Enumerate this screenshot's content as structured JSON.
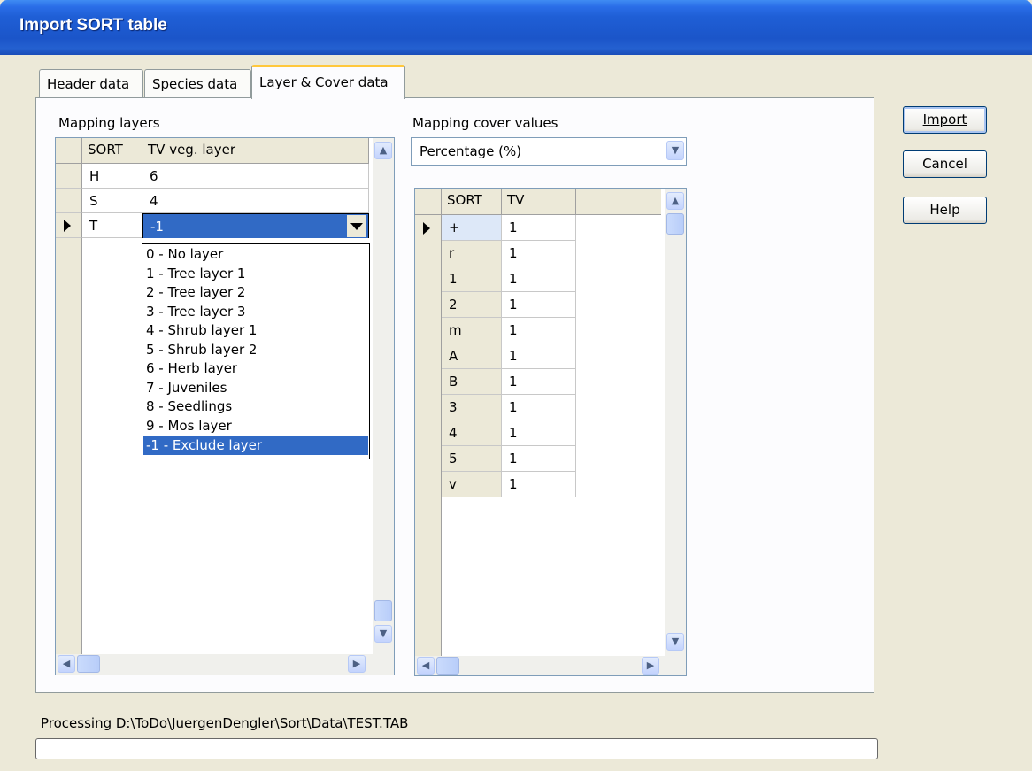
{
  "window": {
    "title": "Import SORT table"
  },
  "tabs": [
    {
      "label": "Header data"
    },
    {
      "label": "Species data"
    },
    {
      "label": "Layer & Cover data"
    }
  ],
  "layers": {
    "label": "Mapping layers",
    "headers": [
      "SORT",
      "TV veg. layer"
    ],
    "rows": [
      {
        "sort": "H",
        "tv": "6"
      },
      {
        "sort": "S",
        "tv": "4"
      },
      {
        "sort": "T",
        "tv": "-1"
      }
    ],
    "dropdown_options": [
      "0 - No layer",
      "1 - Tree layer 1",
      "2 - Tree layer 2",
      "3 - Tree layer 3",
      "4 - Shrub layer 1",
      "5 - Shrub layer 2",
      "6 - Herb layer",
      "7 - Juveniles",
      "8 - Seedlings",
      "9 - Mos layer",
      "-1 - Exclude layer"
    ],
    "dropdown_selected": "-1 - Exclude layer"
  },
  "cover": {
    "label": "Mapping cover values",
    "combo_value": "Percentage (%)",
    "headers": [
      "SORT",
      "TV"
    ],
    "rows": [
      {
        "sort": "+",
        "tv": "1"
      },
      {
        "sort": "r",
        "tv": "1"
      },
      {
        "sort": "1",
        "tv": "1"
      },
      {
        "sort": "2",
        "tv": "1"
      },
      {
        "sort": "m",
        "tv": "1"
      },
      {
        "sort": "A",
        "tv": "1"
      },
      {
        "sort": "B",
        "tv": "1"
      },
      {
        "sort": "3",
        "tv": "1"
      },
      {
        "sort": "4",
        "tv": "1"
      },
      {
        "sort": "5",
        "tv": "1"
      },
      {
        "sort": "v",
        "tv": "1"
      }
    ]
  },
  "buttons": {
    "import": "Import",
    "cancel": "Cancel",
    "help": "Help"
  },
  "status": {
    "text": "Processing D:\\ToDo\\JuergenDengler\\Sort\\Data\\TEST.TAB"
  }
}
